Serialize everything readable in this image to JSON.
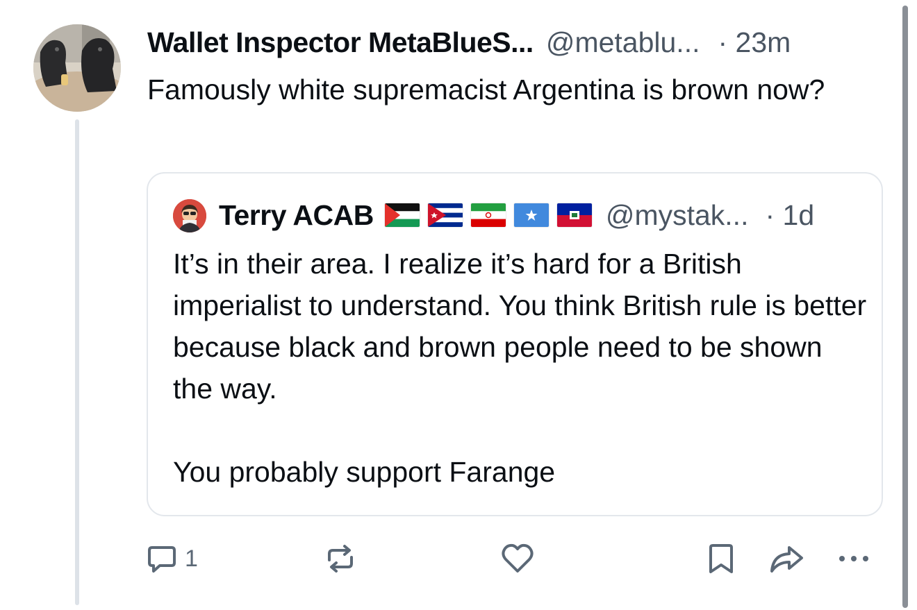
{
  "post": {
    "author_name": "Wallet Inspector MetaBlueS...",
    "author_handle": "@metablu...",
    "timestamp": "· 23m",
    "text": "Famously white supremacist Argentina is brown now?"
  },
  "quoted_post": {
    "author_name": "Terry ACAB",
    "flags": [
      "palestine-flag",
      "cuba-flag",
      "iran-flag",
      "somalia-flag",
      "haiti-flag"
    ],
    "author_handle": "@mystak...",
    "timestamp": "· 1d",
    "paragraphs": [
      "It’s in their area. I realize it’s hard for a British imperialist to understand. You think British rule is better because black and brown people need to be shown the way.",
      "You probably support Farange"
    ]
  },
  "actions": {
    "reply_count": "1",
    "icons": [
      "reply-icon",
      "repost-icon",
      "like-icon",
      "bookmark-icon",
      "share-icon",
      "more-icon"
    ]
  },
  "colors": {
    "text_primary": "#0b0f14",
    "text_secondary": "#4a5562",
    "icon": "#5b6876",
    "border": "#e3e7ec",
    "thread_line": "#dde2e8"
  }
}
